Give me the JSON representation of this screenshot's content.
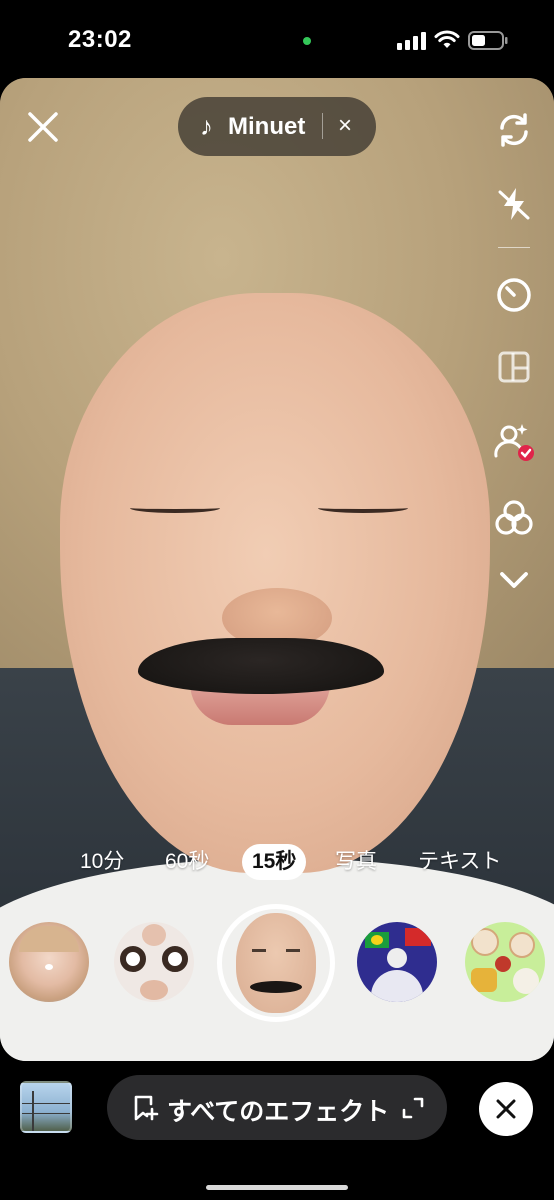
{
  "status_bar": {
    "time": "23:02",
    "camera_indicator_color": "#34c759"
  },
  "music": {
    "note_symbol": "♪",
    "title": "Minuet",
    "remove_symbol": "×"
  },
  "side_icons": [
    "flip-camera-icon",
    "flash-off-icon",
    "timer-icon",
    "layout-icon",
    "collab-check-icon",
    "beauty-filter-icon",
    "more-chevron-icon"
  ],
  "durations": [
    {
      "label": "10分",
      "active": false
    },
    {
      "label": "60秒",
      "active": false
    },
    {
      "label": "15秒",
      "active": true
    },
    {
      "label": "写真",
      "active": false
    },
    {
      "label": "テキスト",
      "active": false
    }
  ],
  "effects": {
    "selected_index": 2,
    "names": [
      "face-effect-thumbnail",
      "big-eyes-effect-thumbnail",
      "mustache-bald-effect-thumbnail",
      "flags-ball-effect-thumbnail",
      "food-effect-thumbnail"
    ]
  },
  "bottom_bar": {
    "all_effects_label": "すべてのエフェクト"
  },
  "colors": {
    "accent_check": "#e0244a",
    "pill_bg": "#2b2b2d"
  }
}
